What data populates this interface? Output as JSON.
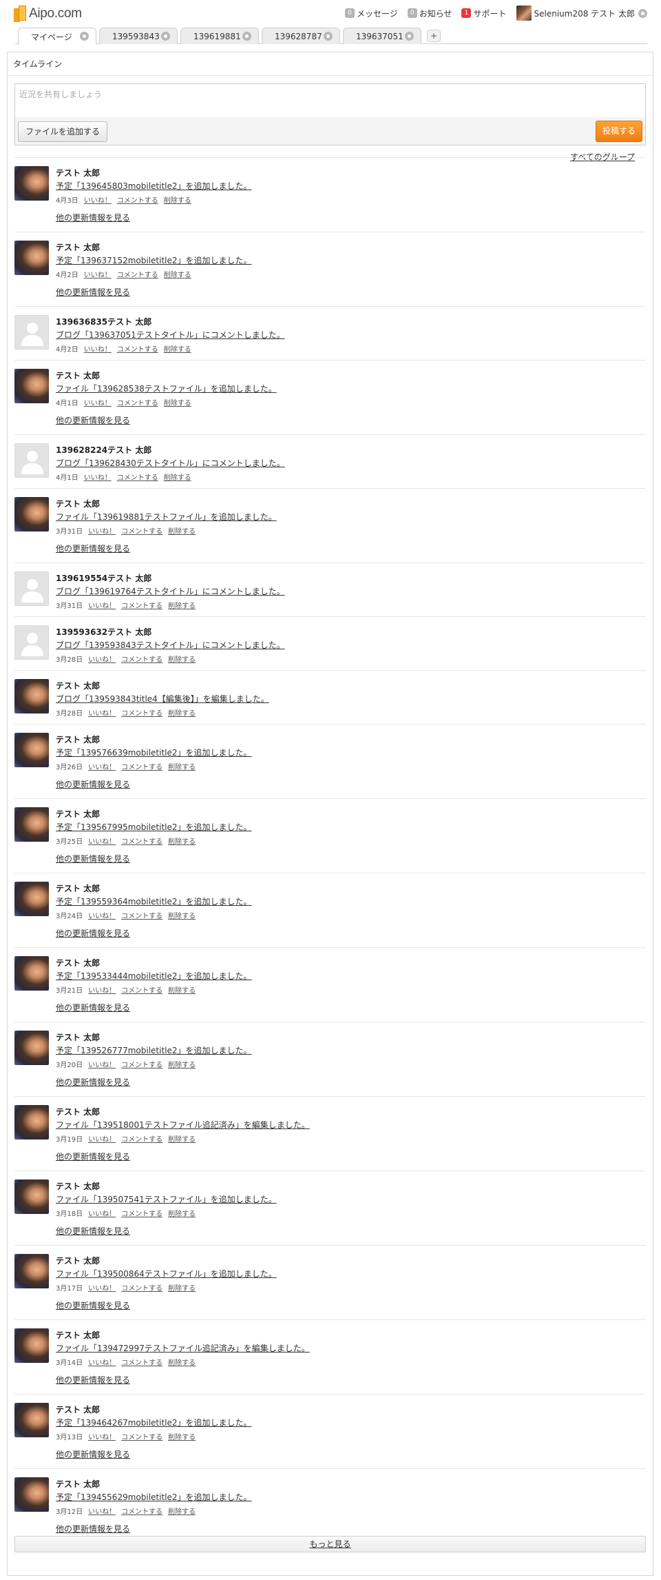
{
  "header": {
    "logo_text": "Aipo.com",
    "nav": {
      "messages": {
        "count": "0",
        "label": "メッセージ"
      },
      "notices": {
        "count": "0",
        "label": "お知らせ"
      },
      "support": {
        "count": "1",
        "label": "サポート"
      },
      "user_name": "Selenium208 テスト 太郎"
    }
  },
  "tabs": [
    {
      "label": "マイページ",
      "active": true
    },
    {
      "label": "139593843"
    },
    {
      "label": "139619881"
    },
    {
      "label": "139628787"
    },
    {
      "label": "139637051"
    }
  ],
  "tab_add_label": "+",
  "timeline": {
    "title": "タイムライン",
    "composer_placeholder": "近況を共有しましょう",
    "add_file_label": "ファイルを追加する",
    "post_label": "投稿する",
    "all_groups_label": "すべてのグループ",
    "like_label": "いいね！",
    "comment_label": "コメントする",
    "delete_label": "削除する",
    "more_updates_label": "他の更新情報を見る",
    "load_more_label": "もっと見る",
    "entries": [
      {
        "name": "テスト 太郎",
        "message": "予定「139645803mobiletitle2」を追加しました。",
        "date": "4月3日",
        "avatar": "photo",
        "more": true
      },
      {
        "name": "テスト 太郎",
        "message": "予定「139637152mobiletitle2」を追加しました。",
        "date": "4月2日",
        "avatar": "photo",
        "more": true
      },
      {
        "name": "139636835テスト 太郎",
        "message": "ブログ「139637051テストタイトル」にコメントしました。",
        "date": "4月2日",
        "avatar": "blank",
        "more": false
      },
      {
        "name": "テスト 太郎",
        "message": "ファイル「139628538テストファイル」を追加しました。",
        "date": "4月1日",
        "avatar": "photo",
        "more": true
      },
      {
        "name": "139628224テスト 太郎",
        "message": "ブログ「139628430テストタイトル」にコメントしました。",
        "date": "4月1日",
        "avatar": "blank",
        "more": false
      },
      {
        "name": "テスト 太郎",
        "message": "ファイル「139619881テストファイル」を追加しました。",
        "date": "3月31日",
        "avatar": "photo",
        "more": true
      },
      {
        "name": "139619554テスト 太郎",
        "message": "ブログ「139619764テストタイトル」にコメントしました。",
        "date": "3月31日",
        "avatar": "blank",
        "more": false
      },
      {
        "name": "139593632テスト 太郎",
        "message": "ブログ「139593843テストタイトル」にコメントしました。",
        "date": "3月28日",
        "avatar": "blank",
        "more": false
      },
      {
        "name": "テスト 太郎",
        "message": "ブログ「139593843title4【編集後】」を編集しました。",
        "date": "3月28日",
        "avatar": "photo",
        "more": false
      },
      {
        "name": "テスト 太郎",
        "message": "予定「139576639mobiletitle2」を追加しました。",
        "date": "3月26日",
        "avatar": "photo",
        "more": true
      },
      {
        "name": "テスト 太郎",
        "message": "予定「139567995mobiletitle2」を追加しました。",
        "date": "3月25日",
        "avatar": "photo",
        "more": true
      },
      {
        "name": "テスト 太郎",
        "message": "予定「139559364mobiletitle2」を追加しました。",
        "date": "3月24日",
        "avatar": "photo",
        "more": true
      },
      {
        "name": "テスト 太郎",
        "message": "予定「139533444mobiletitle2」を追加しました。",
        "date": "3月21日",
        "avatar": "photo",
        "more": true
      },
      {
        "name": "テスト 太郎",
        "message": "予定「139526777mobiletitle2」を追加しました。",
        "date": "3月20日",
        "avatar": "photo",
        "more": true
      },
      {
        "name": "テスト 太郎",
        "message": "ファイル「139518001テストファイル追記済み」を編集しました。",
        "date": "3月19日",
        "avatar": "photo",
        "more": true
      },
      {
        "name": "テスト 太郎",
        "message": "ファイル「139507541テストファイル」を追加しました。",
        "date": "3月18日",
        "avatar": "photo",
        "more": true
      },
      {
        "name": "テスト 太郎",
        "message": "ファイル「139500864テストファイル」を追加しました。",
        "date": "3月17日",
        "avatar": "photo",
        "more": true
      },
      {
        "name": "テスト 太郎",
        "message": "ファイル「139472997テストファイル追記済み」を編集しました。",
        "date": "3月14日",
        "avatar": "photo",
        "more": true
      },
      {
        "name": "テスト 太郎",
        "message": "予定「139464267mobiletitle2」を追加しました。",
        "date": "3月13日",
        "avatar": "photo",
        "more": true
      },
      {
        "name": "テスト 太郎",
        "message": "予定「139455629mobiletitle2」を追加しました。",
        "date": "3月12日",
        "avatar": "photo",
        "more": true
      }
    ]
  }
}
